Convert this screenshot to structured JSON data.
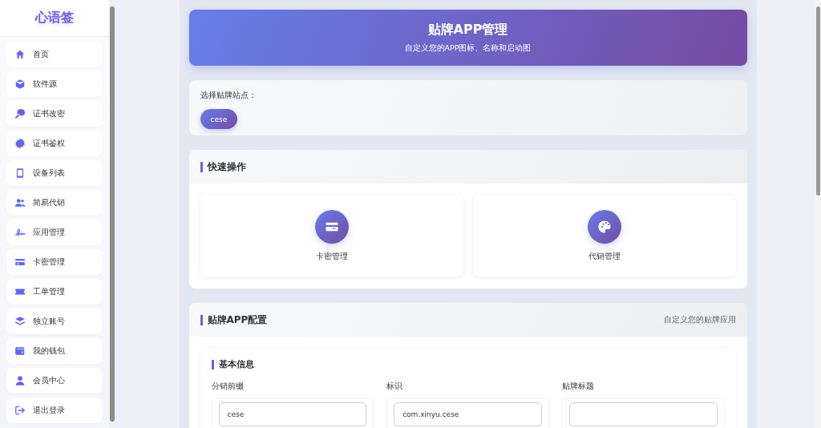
{
  "sidebar": {
    "brand": "心语签",
    "items": [
      {
        "label": "首页"
      },
      {
        "label": "软件源"
      },
      {
        "label": "证书改密"
      },
      {
        "label": "证书鉴权"
      },
      {
        "label": "设备列表"
      },
      {
        "label": "简易代销"
      },
      {
        "label": "应用管理"
      },
      {
        "label": "卡密管理"
      },
      {
        "label": "工单管理"
      },
      {
        "label": "独立账号"
      },
      {
        "label": "我的钱包"
      },
      {
        "label": "会员中心"
      },
      {
        "label": "退出登录"
      }
    ]
  },
  "header": {
    "title": "贴牌APP管理",
    "subtitle": "自定义您的APP图标、名称和启动图"
  },
  "site_picker": {
    "label": "选择贴牌站点：",
    "sites": [
      {
        "label": "cese",
        "selected": true
      }
    ]
  },
  "quick_actions": {
    "title": "快速操作",
    "items": [
      {
        "label": "卡密管理"
      },
      {
        "label": "代销管理"
      }
    ]
  },
  "config": {
    "title": "贴牌APP配置",
    "hint": "自定义您的贴牌应用",
    "section": "基本信息",
    "fields": [
      {
        "label": "分销前缀",
        "value": "cese"
      },
      {
        "label": "标识",
        "value": "com.xinyu.cese"
      },
      {
        "label": "贴牌标题"
      }
    ]
  }
}
